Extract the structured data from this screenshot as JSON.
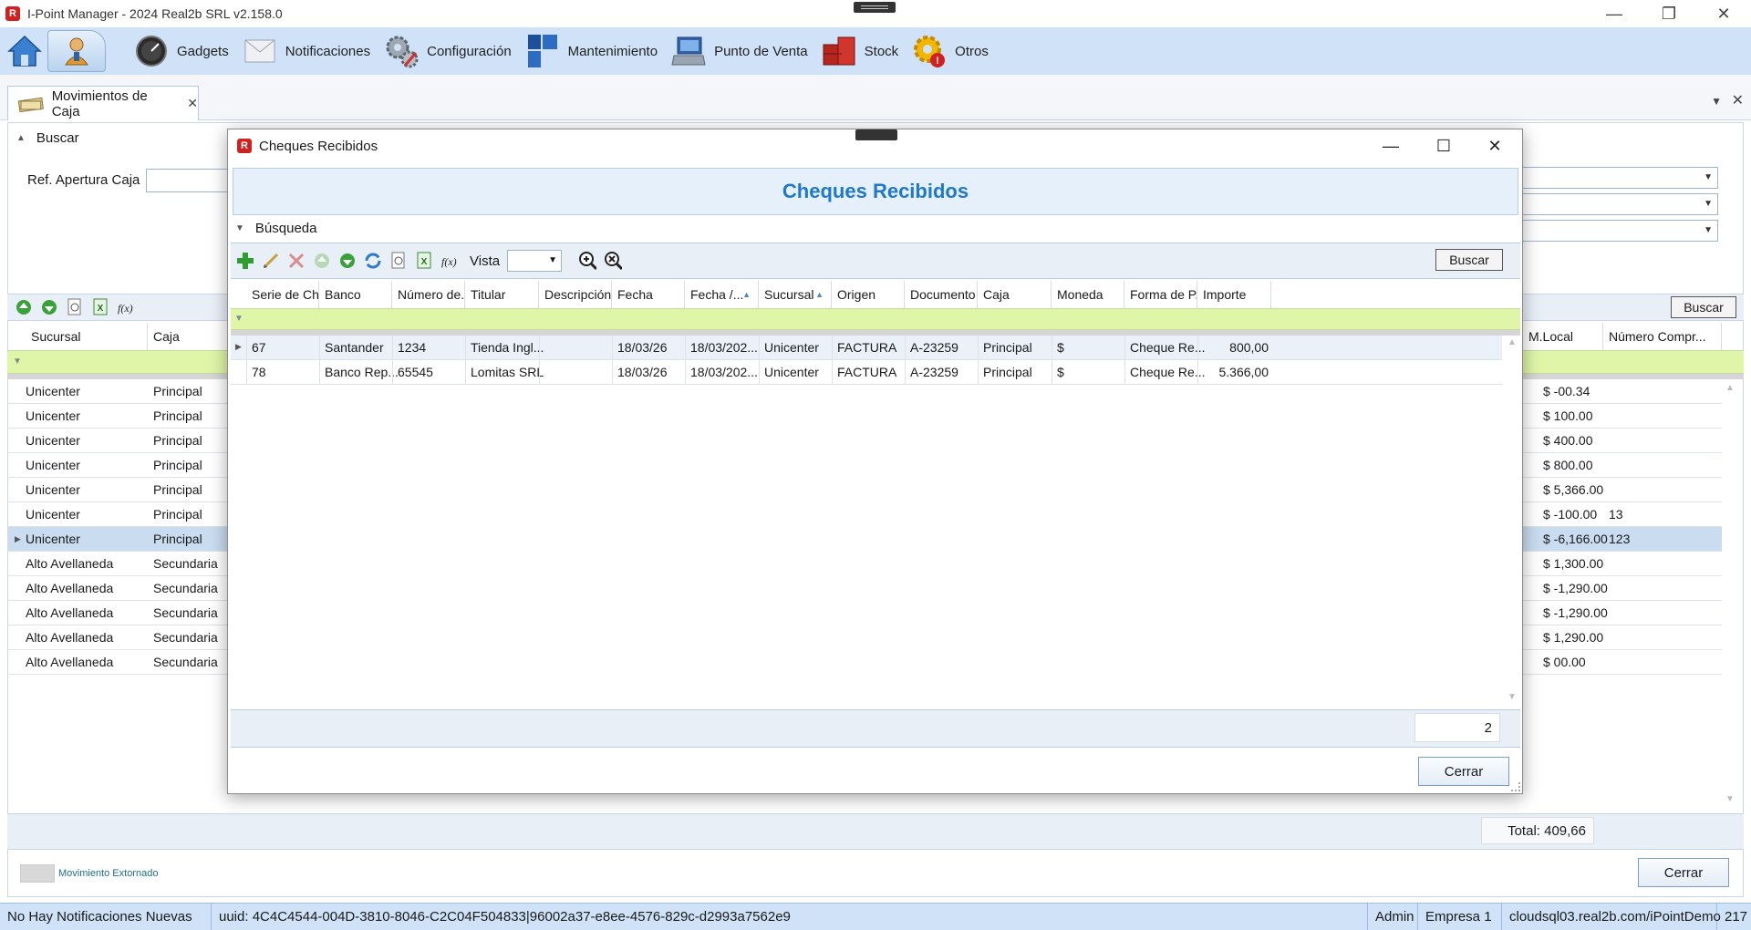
{
  "window": {
    "title": "I-Point Manager - 2024 Real2b SRL v2.158.0",
    "logo_letter": "R",
    "controls": {
      "minimize": "—",
      "restore": "❐",
      "close": "✕"
    }
  },
  "ribbon": {
    "items": [
      {
        "label": "Gadgets",
        "icon": "gauge-icon"
      },
      {
        "label": "Notificaciones",
        "icon": "envelope-icon"
      },
      {
        "label": "Configuración",
        "icon": "gears-icon"
      },
      {
        "label": "Mantenimiento",
        "icon": "tiles-icon"
      },
      {
        "label": "Punto de Venta",
        "icon": "pos-terminal-icon"
      },
      {
        "label": "Stock",
        "icon": "boxes-icon"
      },
      {
        "label": "Otros",
        "icon": "gear-alert-icon"
      }
    ]
  },
  "document_tab": {
    "label": "Movimientos de Caja",
    "close": "✕"
  },
  "tabstrip": {
    "dropdown": "▼",
    "close": "✕"
  },
  "filters": {
    "section_label": "Buscar",
    "collapse_arrow": "▲",
    "ref_apertura_label": "Ref. Apertura Caja",
    "ref_apertura_value": "",
    "combo_arrow": "▼"
  },
  "underlying_toolbar": {
    "buscar_label": "Buscar"
  },
  "underlying_grid": {
    "columns": [
      "Sucursal",
      "Caja",
      "M.Local",
      "Número Compr..."
    ],
    "rows": [
      {
        "sucursal": "Unicenter",
        "caja": "Principal",
        "mlocal": "$ -00.34",
        "numero": ""
      },
      {
        "sucursal": "Unicenter",
        "caja": "Principal",
        "mlocal": "$ 100.00",
        "numero": ""
      },
      {
        "sucursal": "Unicenter",
        "caja": "Principal",
        "mlocal": "$ 400.00",
        "numero": ""
      },
      {
        "sucursal": "Unicenter",
        "caja": "Principal",
        "mlocal": "$ 800.00",
        "numero": ""
      },
      {
        "sucursal": "Unicenter",
        "caja": "Principal",
        "mlocal": "$ 5,366.00",
        "numero": ""
      },
      {
        "sucursal": "Unicenter",
        "caja": "Principal",
        "mlocal": "$ -100.00",
        "numero": "13"
      },
      {
        "sucursal": "Unicenter",
        "caja": "Principal",
        "mlocal": "$ -6,166.00",
        "numero": "123",
        "selected": true
      },
      {
        "sucursal": "Alto Avellaneda",
        "caja": "Secundaria",
        "mlocal": "$ 1,300.00",
        "numero": ""
      },
      {
        "sucursal": "Alto Avellaneda",
        "caja": "Secundaria",
        "mlocal": "$ -1,290.00",
        "numero": ""
      },
      {
        "sucursal": "Alto Avellaneda",
        "caja": "Secundaria",
        "mlocal": "$ -1,290.00",
        "numero": ""
      },
      {
        "sucursal": "Alto Avellaneda",
        "caja": "Secundaria",
        "mlocal": "$ 1,290.00",
        "numero": ""
      },
      {
        "sucursal": "Alto Avellaneda",
        "caja": "Secundaria",
        "mlocal": "$ 00.00",
        "numero": ""
      }
    ],
    "total_label": "Total: 409,66",
    "legend_label": "Movimiento Extornado",
    "cerrar_label": "Cerrar"
  },
  "dialog": {
    "title": "Cheques Recibidos",
    "header": "Cheques Recibidos",
    "busqueda_label": "Búsqueda",
    "vista_label": "Vista",
    "buscar_label": "Buscar",
    "columns": [
      "Serie de Ch...",
      "Banco",
      "Número de...",
      "Titular",
      "Descripción",
      "Fecha",
      "Fecha /...",
      "Sucursal",
      "Origen",
      "Documento",
      "Caja",
      "Moneda",
      "Forma de P...",
      "Importe"
    ],
    "rows": [
      [
        "67",
        "Santander",
        "1234",
        "Tienda Ingl...",
        "",
        "18/03/26",
        "18/03/202...",
        "Unicenter",
        "FACTURA",
        "A-23259",
        "Principal",
        "$",
        "Cheque Re...",
        "800,00"
      ],
      [
        "78",
        "Banco Rep...",
        "65545",
        "Lomitas SRL",
        "",
        "18/03/26",
        "18/03/202...",
        "Unicenter",
        "FACTURA",
        "A-23259",
        "Principal",
        "$",
        "Cheque Re...",
        "5.366,00"
      ]
    ],
    "record_count": "2",
    "cerrar_label": "Cerrar"
  },
  "statusbar": {
    "notifications": "No Hay Notificaciones Nuevas",
    "uuid": "uuid: 4C4C4544-004D-3810-8046-C2C04F504833|96002a37-e8ee-4576-829c-d2993a7562e9",
    "user": "Admin",
    "company": "Empresa 1",
    "server": "cloudsql03.real2b.com/iPointDemo",
    "extra": "217"
  }
}
